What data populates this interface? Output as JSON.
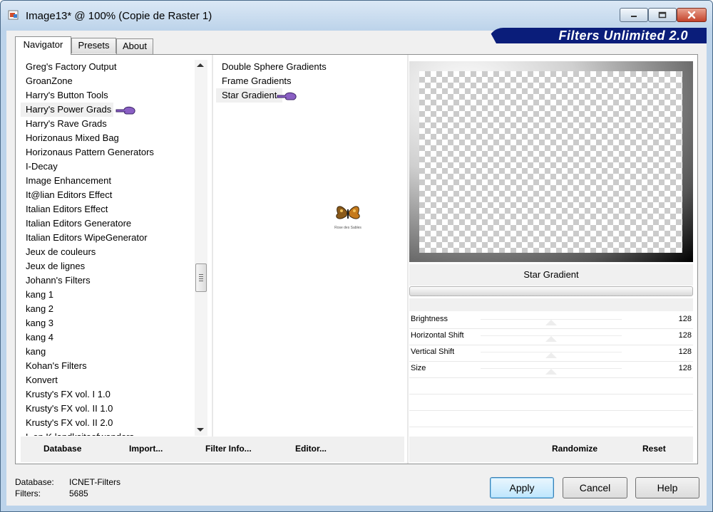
{
  "window": {
    "title": "Image13* @ 100% (Copie de Raster 1)",
    "brand": "Filters Unlimited 2.0"
  },
  "tabs": [
    {
      "label": "Navigator"
    },
    {
      "label": "Presets"
    },
    {
      "label": "About"
    }
  ],
  "categories": [
    "Greg's Factory Output",
    "GroanZone",
    "Harry's Button Tools",
    "Harry's Power Grads",
    "Harry's Rave Grads",
    "Horizonaus Mixed Bag",
    "Horizonaus Pattern Generators",
    "I-Decay",
    "Image Enhancement",
    "It@lian Editors Effect",
    "Italian Editors Effect",
    "Italian Editors Generatore",
    "Italian Editors WipeGenerator",
    "Jeux de couleurs",
    "Jeux de lignes",
    "Johann's Filters",
    "kang 1",
    "kang 2",
    "kang 3",
    "kang 4",
    "kang",
    "Kohan's Filters",
    "Konvert",
    "Krusty's FX vol. I 1.0",
    "Krusty's FX vol. II 1.0",
    "Krusty's FX vol. II 2.0",
    "L en K landksiteofwonders"
  ],
  "filters": [
    "Double Sphere Gradients",
    "Frame Gradients",
    "Star Gradient"
  ],
  "watermark_text": "Rose des Sables",
  "preview": {
    "filter_name": "Star Gradient"
  },
  "sliders": [
    {
      "label": "Brightness",
      "value": "128",
      "level": 0.502
    },
    {
      "label": "Horizontal Shift",
      "value": "128",
      "level": 0.502
    },
    {
      "label": "Vertical Shift",
      "value": "128",
      "level": 0.502
    },
    {
      "label": "Size",
      "value": "128",
      "level": 0.502
    }
  ],
  "bottom_actions": {
    "database": "Database",
    "import": "Import...",
    "filter_info": "Filter Info...",
    "editor": "Editor...",
    "randomize": "Randomize",
    "reset": "Reset"
  },
  "status": {
    "database_label": "Database:",
    "database_value": "ICNET-Filters",
    "filters_label": "Filters:",
    "filters_value": "5685"
  },
  "buttons": {
    "apply": "Apply",
    "cancel": "Cancel",
    "help": "Help"
  },
  "selected": {
    "category": "Harry's Power Grads",
    "filter": "Star Gradient"
  },
  "colors": {
    "brand_bg": "#0a1d7a",
    "pointer_hand": "#8a5fc4"
  },
  "icons": {
    "app": "paint-image-icon",
    "pointer": "pointing-hand-icon",
    "watermark": "butterfly-icon"
  }
}
